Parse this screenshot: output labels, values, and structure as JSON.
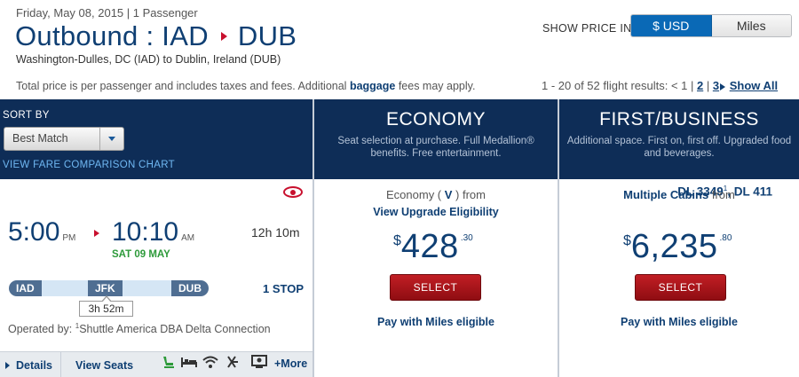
{
  "header": {
    "date_line": "Friday, May 08, 2015 | 1 Passenger",
    "title_prefix": "Outbound : IAD",
    "title_dest": "DUB",
    "route_sub": "Washington-Dulles, DC (IAD) to Dublin, Ireland (DUB)",
    "show_price_label": "SHOW PRICE IN",
    "price_options": [
      "$ USD",
      "Miles"
    ],
    "price_note_before": "Total price is per passenger and includes taxes and fees. Additional ",
    "price_note_link": "baggage",
    "price_note_after": " fees may apply.",
    "pagination_prefix": "1 - 20 of 52 flight results: < 1 | ",
    "pagination_pages": [
      "2",
      "3"
    ],
    "show_all": "Show All"
  },
  "sort": {
    "label": "SORT BY",
    "selected": "Best Match",
    "compare_link": "VIEW FARE COMPARISON CHART"
  },
  "cabins": [
    {
      "name": "ECONOMY",
      "desc": "Seat selection at purchase. Full Medallion® benefits. Free entertainment."
    },
    {
      "name": "FIRST/BUSINESS",
      "desc": "Additional space. First on, first off. Upgraded food and beverages."
    }
  ],
  "flight": {
    "num1": "DL 3349",
    "num1_sup": "1",
    "num2": ", DL 411",
    "dep_time": "5:00",
    "dep_ampm": "PM",
    "arr_time": "10:10",
    "arr_ampm": "AM",
    "arr_date": "SAT 09 MAY",
    "duration": "12h 10m",
    "airports": [
      "IAD",
      "JFK",
      "DUB"
    ],
    "layover": "3h 52m",
    "stops": "1 STOP",
    "operated_prefix": "Operated by: ",
    "operated_sup": "1",
    "operated_by": "Shuttle America DBA Delta Connection",
    "details": "Details",
    "view_seats": "View Seats",
    "amenities": [
      "seat-icon",
      "bed-icon",
      "wifi-icon",
      "power-icon",
      "entertainment-icon"
    ],
    "more": "+More"
  },
  "economy": {
    "label_prefix": "Economy ( ",
    "fare_class": "V",
    "label_suffix": " ) from",
    "upgrade": "View Upgrade Eligibility",
    "currency": "$",
    "amount": "428",
    "cents": ".30",
    "select": "SELECT",
    "miles": "Pay with Miles eligible"
  },
  "first": {
    "label_bold": "Multiple Cabins",
    "label_suffix": " from",
    "currency": "$",
    "amount": "6,235",
    "cents": ".80",
    "select": "SELECT",
    "miles": "Pay with Miles eligible"
  },
  "colors": {
    "navy": "#0e2d57",
    "link": "#0f3f73",
    "red": "#c8102e",
    "green": "#2d9a3a",
    "active_toggle": "#0a69b6"
  }
}
